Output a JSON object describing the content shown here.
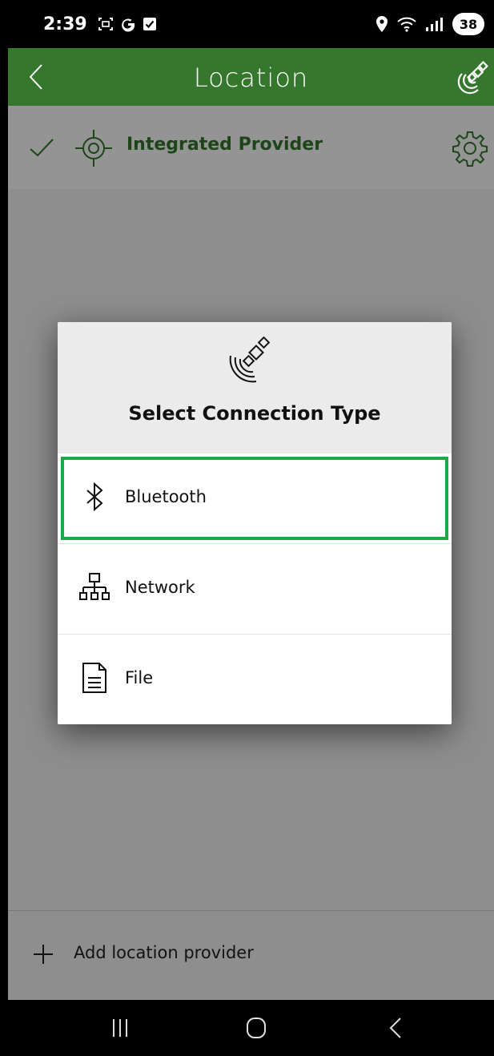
{
  "status_bar": {
    "time": "2:39",
    "battery": "38",
    "icons_left": [
      "screenshot-icon",
      "google-g-icon",
      "check-box-icon"
    ],
    "icons_right": [
      "location-pin-icon",
      "wifi-icon",
      "signal-icon"
    ]
  },
  "app_bar": {
    "title": "Location",
    "back_icon": "chevron-left-icon",
    "action_icon": "satellite-icon"
  },
  "provider": {
    "label": "Integrated Provider",
    "check_icon": "checkmark-icon",
    "target_icon": "crosshair-icon",
    "settings_icon": "gear-icon"
  },
  "footer": {
    "label": "Add location provider",
    "icon": "plus-icon"
  },
  "dialog": {
    "title": "Select Connection Type",
    "header_icon": "satellite-icon",
    "options": [
      {
        "label": "Bluetooth",
        "icon": "bluetooth-icon",
        "selected": true
      },
      {
        "label": "Network",
        "icon": "network-icon",
        "selected": false
      },
      {
        "label": "File",
        "icon": "file-icon",
        "selected": false
      }
    ]
  },
  "nav_bar": {
    "recents_icon": "recents-icon",
    "home_icon": "home-icon",
    "back_icon": "back-icon"
  },
  "colors": {
    "brand_green": "#35782d",
    "selection_green": "#1aa84a",
    "dialog_header_bg": "#ebebeb"
  }
}
